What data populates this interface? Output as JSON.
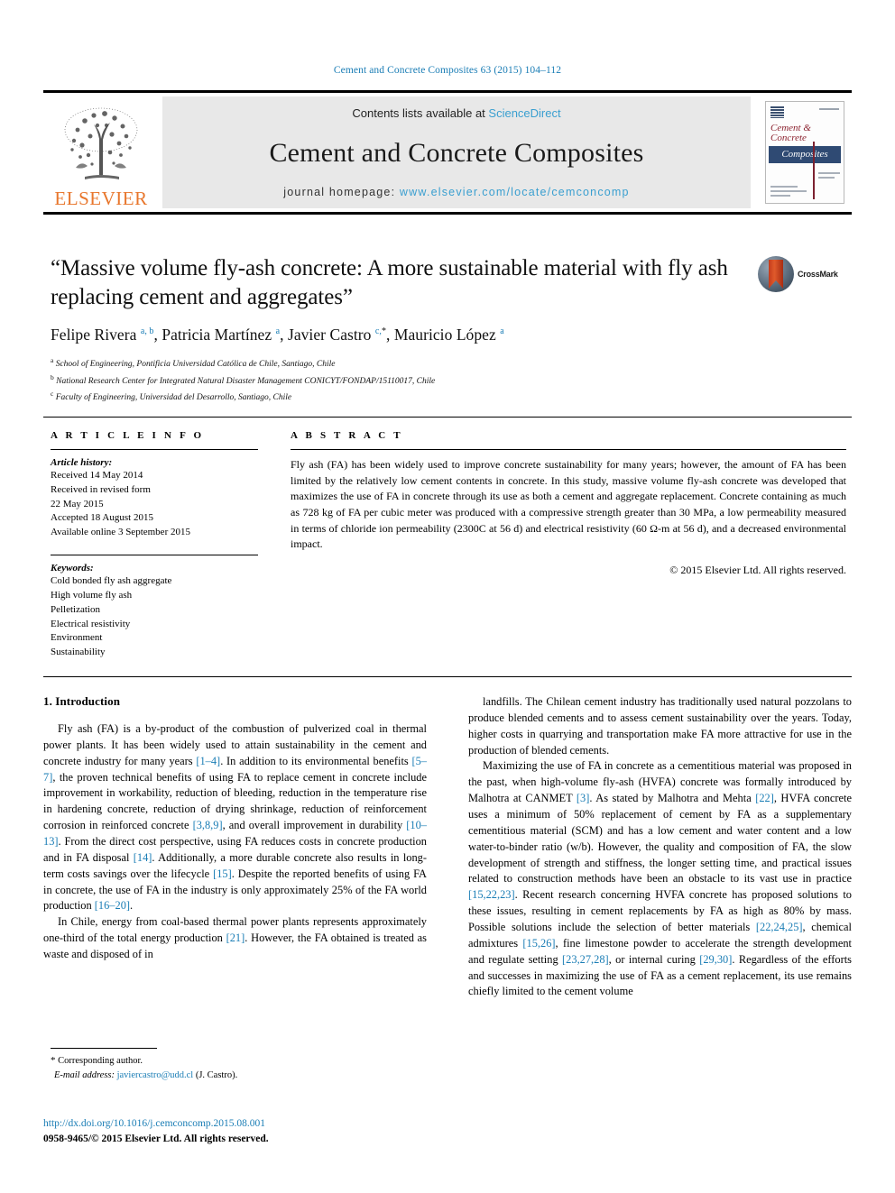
{
  "running_head": "Cement and Concrete Composites 63 (2015) 104–112",
  "header": {
    "publisher_logo_text": "ELSEVIER",
    "contents_prefix": "Contents lists available at ",
    "contents_link": "ScienceDirect",
    "journal_title": "Cement and Concrete Composites",
    "homepage_prefix": "journal homepage: ",
    "homepage_url": "www.elsevier.com/locate/cemconcomp",
    "cover": {
      "line1": "Cement &",
      "line2": "Concrete",
      "band": "Composites"
    }
  },
  "article": {
    "title": "“Massive volume fly-ash concrete: A more sustainable material with fly ash replacing cement and aggregates”",
    "crossmark_label": "CrossMark",
    "authors_html": "Felipe Rivera <sup>a, b</sup>, Patricia Martínez <sup>a</sup>, Javier Castro <sup>c,</sup><sup class=\"star\">*</sup>, Mauricio López <sup>a</sup>",
    "affiliations": [
      {
        "mark": "a",
        "text": "School of Engineering, Pontificia Universidad Católica de Chile, Santiago, Chile"
      },
      {
        "mark": "b",
        "text": "National Research Center for Integrated Natural Disaster Management CONICYT/FONDAP/15110017, Chile"
      },
      {
        "mark": "c",
        "text": "Faculty of Engineering, Universidad del Desarrollo, Santiago, Chile"
      }
    ]
  },
  "article_info": {
    "heading": "A R T I C L E  I N F O",
    "history_label": "Article history:",
    "history": [
      "Received 14 May 2014",
      "Received in revised form",
      "22 May 2015",
      "Accepted 18 August 2015",
      "Available online 3 September 2015"
    ],
    "keywords_label": "Keywords:",
    "keywords": [
      "Cold bonded fly ash aggregate",
      "High volume fly ash",
      "Pelletization",
      "Electrical resistivity",
      "Environment",
      "Sustainability"
    ]
  },
  "abstract": {
    "heading": "A B S T R A C T",
    "text": "Fly ash (FA) has been widely used to improve concrete sustainability for many years; however, the amount of FA has been limited by the relatively low cement contents in concrete. In this study, massive volume fly-ash concrete was developed that maximizes the use of FA in concrete through its use as both a cement and aggregate replacement. Concrete containing as much as 728 kg of FA per cubic meter was produced with a compressive strength greater than 30 MPa, a low permeability measured in terms of chloride ion permeability (2300C at 56 d) and electrical resistivity (60 Ω-m at 56 d), and a decreased environmental impact.",
    "copyright": "© 2015 Elsevier Ltd. All rights reserved."
  },
  "body": {
    "section_title": "1. Introduction",
    "left_paragraphs": [
      "Fly ash (FA) is a by-product of the combustion of pulverized coal in thermal power plants. It has been widely used to attain sustainability in the cement and concrete industry for many years [1–4]. In addition to its environmental benefits [5–7], the proven technical benefits of using FA to replace cement in concrete include improvement in workability, reduction of bleeding, reduction in the temperature rise in hardening concrete, reduction of drying shrinkage, reduction of reinforcement corrosion in reinforced concrete [3,8,9], and overall improvement in durability [10–13]. From the direct cost perspective, using FA reduces costs in concrete production and in FA disposal [14]. Additionally, a more durable concrete also results in long-term costs savings over the lifecycle [15]. Despite the reported benefits of using FA in concrete, the use of FA in the industry is only approximately 25% of the FA world production [16–20].",
      "In Chile, energy from coal-based thermal power plants represents approximately one-third of the total energy production [21]. However, the FA obtained is treated as waste and disposed of in"
    ],
    "right_paragraphs": [
      "landfills. The Chilean cement industry has traditionally used natural pozzolans to produce blended cements and to assess cement sustainability over the years. Today, higher costs in quarrying and transportation make FA more attractive for use in the production of blended cements.",
      "Maximizing the use of FA in concrete as a cementitious material was proposed in the past, when high-volume fly-ash (HVFA) concrete was formally introduced by Malhotra at CANMET [3]. As stated by Malhotra and Mehta [22], HVFA concrete uses a minimum of 50% replacement of cement by FA as a supplementary cementitious material (SCM) and has a low cement and water content and a low water-to-binder ratio (w/b). However, the quality and composition of FA, the slow development of strength and stiffness, the longer setting time, and practical issues related to construction methods have been an obstacle to its vast use in practice [15,22,23]. Recent research concerning HVFA concrete has proposed solutions to these issues, resulting in cement replacements by FA as high as 80% by mass. Possible solutions include the selection of better materials [22,24,25], chemical admixtures [15,26], fine limestone powder to accelerate the strength development and regulate setting [23,27,28], or internal curing [29,30]. Regardless of the efforts and successes in maximizing the use of FA as a cement replacement, its use remains chiefly limited to the cement volume"
    ]
  },
  "footnote": {
    "star": "*",
    "corresponding": "Corresponding author.",
    "email_label": "E-mail address:",
    "email": "javiercastro@udd.cl",
    "email_suffix": "(J. Castro)."
  },
  "footer": {
    "doi": "http://dx.doi.org/10.1016/j.cemconcomp.2015.08.001",
    "issn": "0958-9465/© 2015 Elsevier Ltd. All rights reserved."
  },
  "colors": {
    "link_blue": "#1a7db5",
    "science_direct_blue": "#3a9fd0",
    "elsevier_orange": "#E8762C",
    "cover_maroon": "#8c2330",
    "cover_navy": "#2f4a73",
    "crossmark_red": "#c43b1c"
  }
}
